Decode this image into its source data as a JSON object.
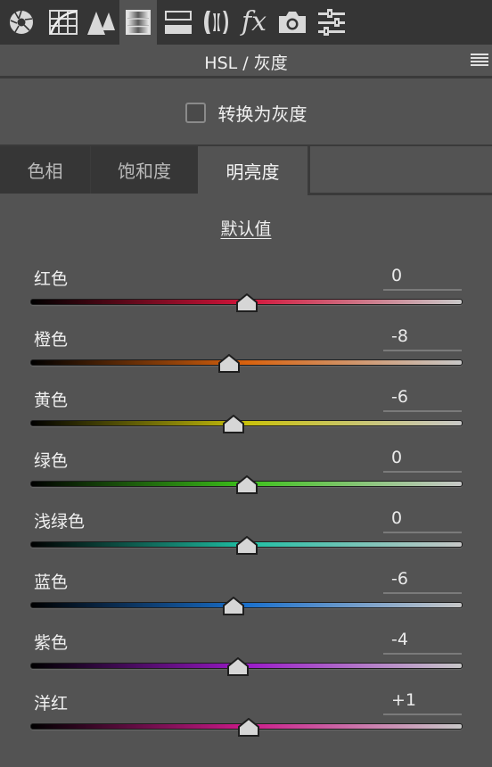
{
  "toolbar": {
    "tools": [
      {
        "name": "basic-icon",
        "active": false
      },
      {
        "name": "tone-curve-icon",
        "active": false
      },
      {
        "name": "detail-icon",
        "active": false
      },
      {
        "name": "hsl-icon",
        "active": true
      },
      {
        "name": "split-toning-icon",
        "active": false
      },
      {
        "name": "lens-corrections-icon",
        "active": false
      },
      {
        "name": "effects-icon",
        "active": false
      },
      {
        "name": "camera-calibration-icon",
        "active": false
      },
      {
        "name": "presets-sliders-icon",
        "active": false
      }
    ],
    "fx_label": "fx"
  },
  "panel": {
    "title": "HSL / 灰度",
    "menu_icon": "hamburger-menu-icon"
  },
  "grayscale": {
    "label": "转换为灰度",
    "checked": false
  },
  "tabs": [
    {
      "label": "色相",
      "active": false
    },
    {
      "label": "饱和度",
      "active": false
    },
    {
      "label": "明亮度",
      "active": true
    }
  ],
  "default_link": "默认值",
  "range": {
    "min": -100,
    "max": 100
  },
  "sliders": [
    {
      "label": "红色",
      "value": "0",
      "numeric": 0,
      "color": "#d4143a"
    },
    {
      "label": "橙色",
      "value": "-8",
      "numeric": -8,
      "color": "#d9620e"
    },
    {
      "label": "黄色",
      "value": "-6",
      "numeric": -6,
      "color": "#c9c10c"
    },
    {
      "label": "绿色",
      "value": "0",
      "numeric": 0,
      "color": "#3cc11a"
    },
    {
      "label": "浅绿色",
      "value": "0",
      "numeric": 0,
      "color": "#1fbfa4"
    },
    {
      "label": "蓝色",
      "value": "-6",
      "numeric": -6,
      "color": "#1a70cc"
    },
    {
      "label": "紫色",
      "value": "-4",
      "numeric": -4,
      "color": "#9a1ac8"
    },
    {
      "label": "洋红",
      "value": "+1",
      "numeric": 1,
      "color": "#cc1a8a"
    }
  ]
}
